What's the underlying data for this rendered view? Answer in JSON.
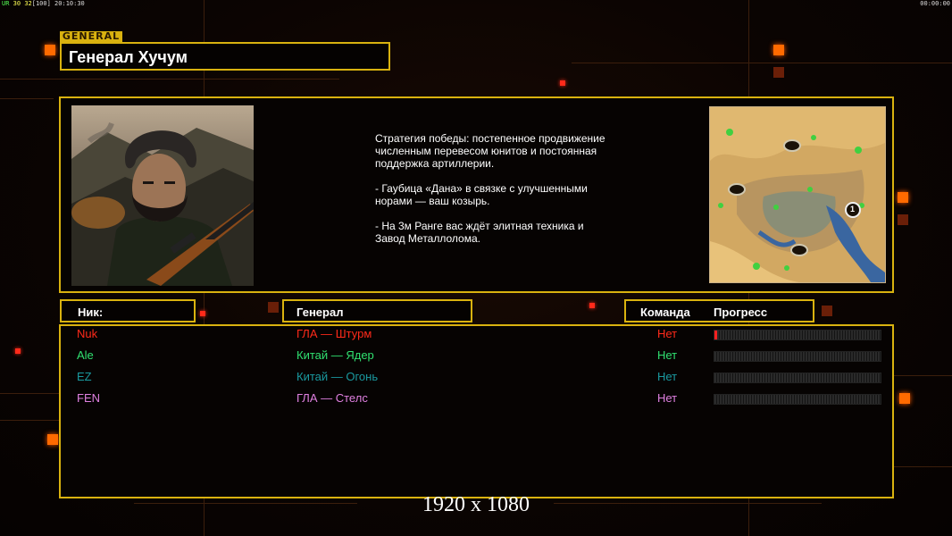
{
  "hud": {
    "ur": "UR",
    "n1": "30",
    "n2": "32",
    "n3": "[100]",
    "time_left": "20:10:30",
    "time_right": "00:00:00"
  },
  "general": {
    "tag": "GENERAL",
    "name": "Генерал Хучум"
  },
  "description": [
    "Стратегия победы: постепенное продвижение численным перевесом юнитов и постоянная поддержка артиллерии.",
    "- Гаубица «Дана» в связке с улучшенными норами — ваш козырь.",
    "- На 3м Ранге вас ждёт элитная техника и Завод Металлолома."
  ],
  "minimap": {
    "marker_label": "1"
  },
  "headers": {
    "nick": "Ник:",
    "general": "Генерал",
    "team": "Команда",
    "progress": "Прогресс"
  },
  "players": [
    {
      "nick": "Nuk",
      "general": "ГЛА — Штурм",
      "team": "Нет",
      "color": "#ff2a1a",
      "progress": 0.01
    },
    {
      "nick": "Ale",
      "general": "Китай — Ядер",
      "team": "Нет",
      "color": "#30e070",
      "progress": 0
    },
    {
      "nick": "EZ",
      "general": "Китай — Огонь",
      "team": "Нет",
      "color": "#1a9aa0",
      "progress": 0
    },
    {
      "nick": "FEN",
      "general": "ГЛА — Стелс",
      "team": "Нет",
      "color": "#e080e0",
      "progress": 0
    }
  ],
  "resolution": "1920 x 1080",
  "colors": {
    "frame": "#d9b20f",
    "accent": "#ff6a00"
  }
}
